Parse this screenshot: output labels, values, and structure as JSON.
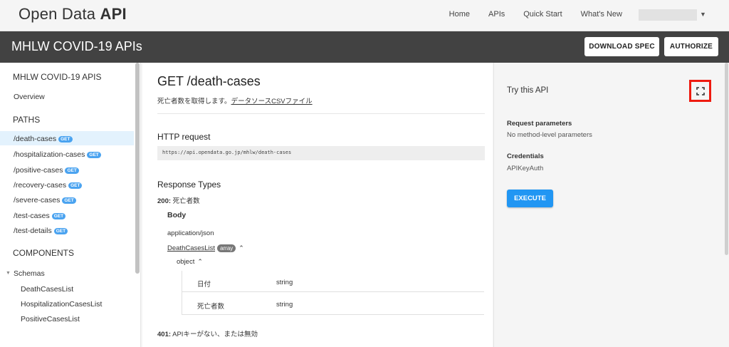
{
  "header": {
    "brand_light": "Open Data ",
    "brand_bold": "API",
    "nav": [
      "Home",
      "APIs",
      "Quick Start",
      "What's New"
    ]
  },
  "titlebar": {
    "title": "MHLW COVID-19 APIs",
    "download_label": "DOWNLOAD SPEC",
    "authorize_label": "AUTHORIZE"
  },
  "sidebar": {
    "api_title": "MHLW COVID-19 APIS",
    "overview": "Overview",
    "paths_heading": "PATHS",
    "paths": [
      {
        "label": "/death-cases",
        "badge": "GET"
      },
      {
        "label": "/hospitalization-cases",
        "badge": "GET"
      },
      {
        "label": "/positive-cases",
        "badge": "GET"
      },
      {
        "label": "/recovery-cases",
        "badge": "GET"
      },
      {
        "label": "/severe-cases",
        "badge": "GET"
      },
      {
        "label": "/test-cases",
        "badge": "GET"
      },
      {
        "label": "/test-details",
        "badge": "GET"
      }
    ],
    "components_heading": "COMPONENTS",
    "schemas_label": "Schemas",
    "schemas": [
      "DeathCasesList",
      "HospitalizationCasesList",
      "PositiveCasesList"
    ]
  },
  "main": {
    "title": "GET /death-cases",
    "desc_text": "死亡者数を取得します。",
    "desc_link": "データソースCSVファイル",
    "http_heading": "HTTP request",
    "url": "https://api.opendata.go.jp/mhlw/death-cases",
    "resp_heading": "Response Types",
    "resp200_code": "200:",
    "resp200_text": " 死亡者数",
    "body_label": "Body",
    "content_type": "application/json",
    "schema_link": "DeathCasesList",
    "array_pill": "array",
    "object_label": "object",
    "fields": [
      {
        "name": "日付",
        "type": "string"
      },
      {
        "name": "死亡者数",
        "type": "string"
      }
    ],
    "resp401_code": "401:",
    "resp401_text": " APIキーがない、または無効"
  },
  "tryapi": {
    "title": "Try this API",
    "req_heading": "Request parameters",
    "req_text": "No method-level parameters",
    "cred_heading": "Credentials",
    "cred_text": "APIKeyAuth",
    "execute_label": "EXECUTE"
  },
  "icons": {
    "fullscreen": "fullscreen-icon",
    "user_caret": "chevron-down-icon",
    "expand_caret": "chevron-up-icon"
  },
  "colors": {
    "accent": "#2196f3",
    "badge": "#4aa3f0",
    "titlebar": "#424242",
    "highlight_box": "#ee1b10",
    "selected_row": "#e3f2fd"
  }
}
